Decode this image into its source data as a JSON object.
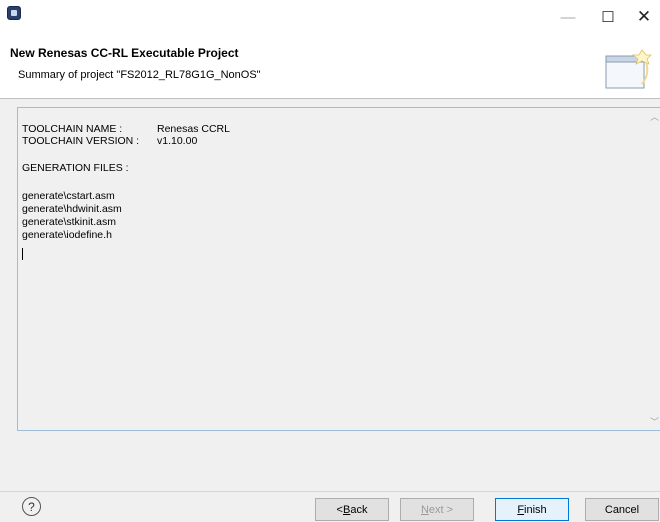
{
  "window": {
    "minimize_icon": "minimize-icon",
    "maximize_icon": "maximize-icon",
    "close_icon": "close-icon"
  },
  "header": {
    "title": "New Renesas CC-RL Executable Project",
    "subtitle": "Summary of project \"FS2012_RL78G1G_NonOS\""
  },
  "summary": {
    "toolchain_name_label": "TOOLCHAIN NAME :",
    "toolchain_name_value": "Renesas CCRL",
    "toolchain_version_label": "TOOLCHAIN VERSION :",
    "toolchain_version_value": "v1.10.00",
    "generation_files_label": "GENERATION FILES :",
    "files": [
      "generate\\cstart.asm",
      "generate\\hdwinit.asm",
      "generate\\stkinit.asm",
      "generate\\iodefine.h"
    ]
  },
  "footer": {
    "help_label": "?",
    "back_prefix": "< ",
    "back_mn": "B",
    "back_rest": "ack",
    "next_mn": "N",
    "next_rest": "ext >",
    "finish_mn": "F",
    "finish_rest": "inish",
    "cancel_label": "Cancel"
  },
  "colors": {
    "accent": "#0078d7",
    "border": "#9dbcd8"
  }
}
